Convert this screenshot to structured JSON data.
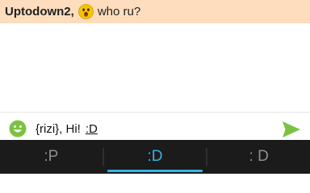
{
  "message": {
    "sender": "Uptodown2,",
    "emoji": "shocked-face-icon",
    "text": "who ru?"
  },
  "input": {
    "text": "{rizi}, Hi!",
    "suggestion_underlined": ":D"
  },
  "suggestions": [
    ":P",
    ":D",
    ": D"
  ],
  "active_suggestion": ":D",
  "icons": {
    "left": "smiley-face-icon",
    "right": "send-arrow-icon"
  },
  "colors": {
    "message_bar": "#fdddbd",
    "accent": "#33b5e5",
    "emoji_face": "#7cc242",
    "send_arrow": "#7cc242",
    "keyboard_bg": "#1b1b1b"
  }
}
